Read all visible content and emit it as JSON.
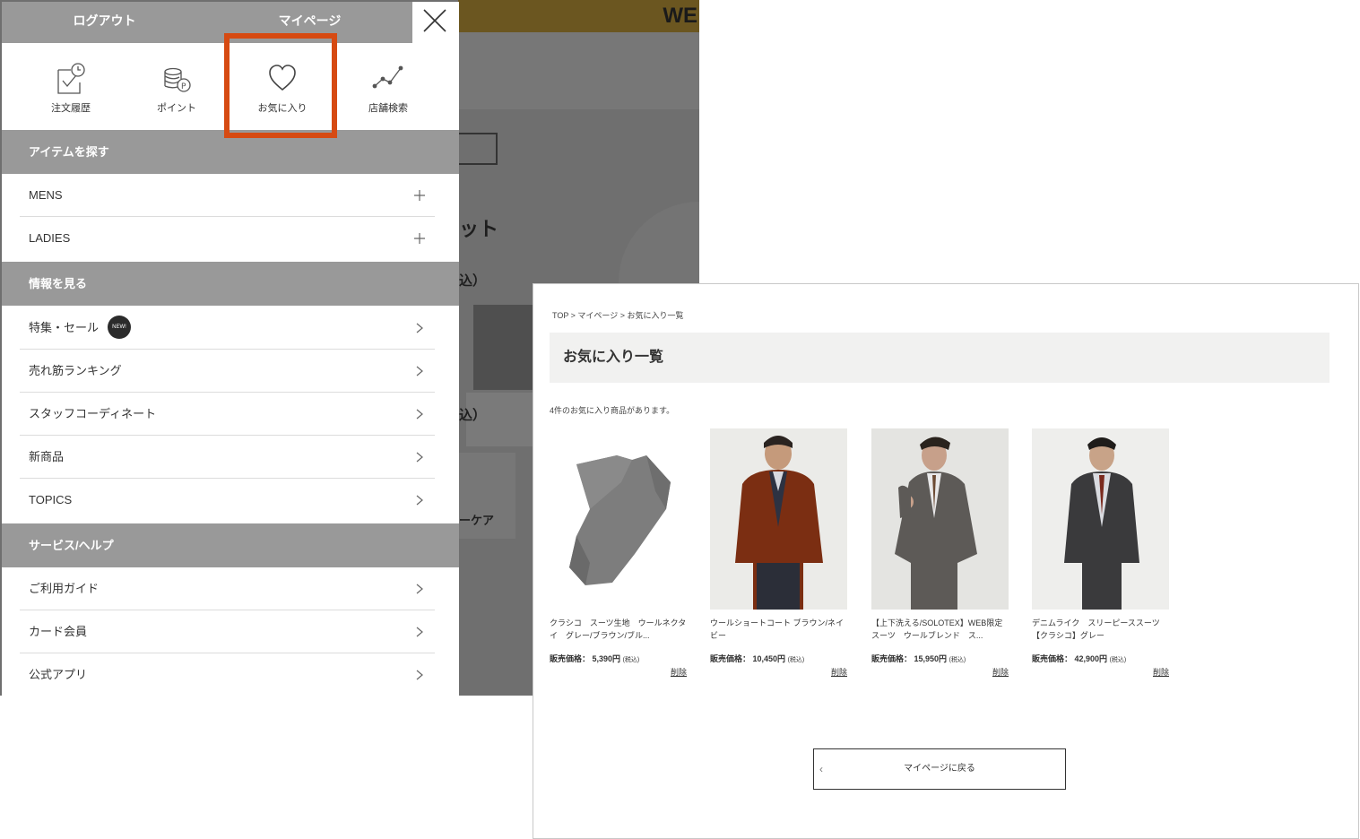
{
  "background_page": {
    "banner_text": "WE",
    "fragments": [
      "ット",
      "込）",
      "込）",
      "ーケア"
    ]
  },
  "drawer": {
    "header": {
      "logout": "ログアウト",
      "mypage": "マイページ"
    },
    "quick_menu": [
      {
        "label": "注文履歴",
        "icon": "order-history-icon"
      },
      {
        "label": "ポイント",
        "icon": "points-icon"
      },
      {
        "label": "お気に入り",
        "icon": "heart-icon"
      },
      {
        "label": "店舗検索",
        "icon": "store-search-icon"
      }
    ],
    "sections": [
      {
        "title": "アイテムを探す",
        "items": [
          "MENS",
          "LADIES"
        ]
      },
      {
        "title": "情報を見る",
        "items": [
          "特集・セール",
          "売れ筋ランキング",
          "スタッフコーディネート",
          "新商品",
          "TOPICS"
        ],
        "new_badge": "NEW!"
      },
      {
        "title": "サービス/ヘルプ",
        "items": [
          "ご利用ガイド",
          "カード会員",
          "公式アプリ"
        ]
      }
    ],
    "highlight_color": "#d64a12"
  },
  "favorites": {
    "breadcrumb": "TOP > マイページ > お気に入り一覧",
    "title": "お気に入り一覧",
    "count_text": "4件のお気に入り商品があります。",
    "price_label": "販売価格：",
    "tax_label": "(税込)",
    "delete_label": "削除",
    "products": [
      {
        "name": "クラシコ　スーツ生地　ウールネクタイ　グレー/ブラウン/ブル...",
        "price": "5,390円"
      },
      {
        "name": "ウールショートコート ブラウン/ネイビー",
        "price": "10,450円"
      },
      {
        "name": "【上下洗える/SOLOTEX】WEB限定スーツ　ウールブレンド　ス...",
        "price": "15,950円"
      },
      {
        "name": "デニムライク　スリーピーススーツ【クラシコ】グレー",
        "price": "42,900円"
      }
    ],
    "back_button": "マイページに戻る"
  }
}
